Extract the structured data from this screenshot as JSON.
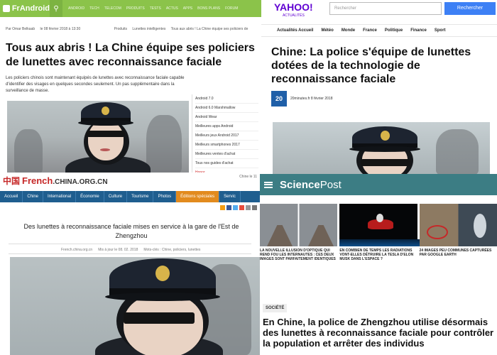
{
  "frandroid": {
    "logo": "FrAndroid",
    "menu": [
      "ANDROID",
      "TECH",
      "TELECOM",
      "PRODUITS",
      "TESTS",
      "ACTUS",
      "APPS",
      "BONS PLANS",
      "FORUM"
    ],
    "author": "Par Omar Belkaab",
    "date": "le 08 février 2018 à 13:30",
    "breadcrumb": [
      "Produits",
      "Lunettes intelligentes",
      "Tous aux abris ! La Chine équipe ses policiers de"
    ],
    "title": "Tous aux abris ! La Chine équipe ses policiers de lunettes avec reconnaissance faciale",
    "lead": "Les policiers chinois sont maintenant équipés de lunettes avec reconnaissance faciale capable d'identifier des visages en quelques secondes seulement. Un pas supplémentaire dans la surveillance de masse.",
    "sidebar": [
      "Android 7.0",
      "Android 6.0 Marshmallow",
      "Android Wear",
      "Meilleures apps Android",
      "Meilleurs jeux Android 2017",
      "Meilleurs smartphones 2017",
      "Meilleures ventes d'achat",
      "Tous nos guides d'achat",
      "Honor"
    ],
    "accent": "#8bc34a"
  },
  "yahoo": {
    "logo": "YAHOO!",
    "logo_sub": "ACTUALITÉS",
    "search_placeholder": "Rechercher",
    "search_button": "Rechercher",
    "nav": [
      "Actualités Accueil",
      "Météo",
      "Monde",
      "France",
      "Politique",
      "Finance",
      "Sport"
    ],
    "title": "Chine: La police s'équipe de lunettes dotées de la technologie de reconnaissance faciale",
    "source_icon": "20",
    "source": "20minutes.fr",
    "date": "8 février 2018",
    "accent": "#6001d2"
  },
  "china": {
    "flag": "中国",
    "logo": "French",
    "logo_domain": ".CHINA.ORG.CN",
    "top_right": "Chine le 11",
    "nav": [
      "Accueil",
      "Chine",
      "International",
      "Économie",
      "Culture",
      "Tourisme",
      "Photos",
      "Éditions spéciales",
      "Servic"
    ],
    "title": "Des lunettes à reconnaissance faciale mises en service à la gare de l'Est de Zhengzhou",
    "meta": [
      "French.china.org.cn",
      "Mis à jour le 08. 02. 2018",
      "Mots-clés : Chine, policiers, lunettes"
    ],
    "nav_color": "#1f5e8f",
    "brand_color": "#c62828"
  },
  "sciencepost": {
    "logo_a": "Science",
    "logo_b": "Post",
    "thumbs": [
      {
        "caption": "LA NOUVELLE ILLUSION D'OPTIQUE QUI REND FOU LES INTERNAUTES : CES DEUX IMAGES SONT PARFAITEMENT IDENTIQUES"
      },
      {
        "caption": "EN COMBIEN DE TEMPS LES RADIATIONS VONT-ELLES DÉTRUIRE LA TESLA D'ELON MUSK DANS L'ESPACE ?"
      },
      {
        "caption": "24 IMAGES PEU COMMUNES CAPTURÉES PAR GOOGLE EARTH"
      }
    ],
    "tag": "SOCIÉTÉ",
    "title": "En Chine, la police de Zhengzhou utilise désormais des lunettes à reconnaissance faciale pour contrôler la population et arrêter des individus",
    "header_color": "#3c7d84"
  }
}
